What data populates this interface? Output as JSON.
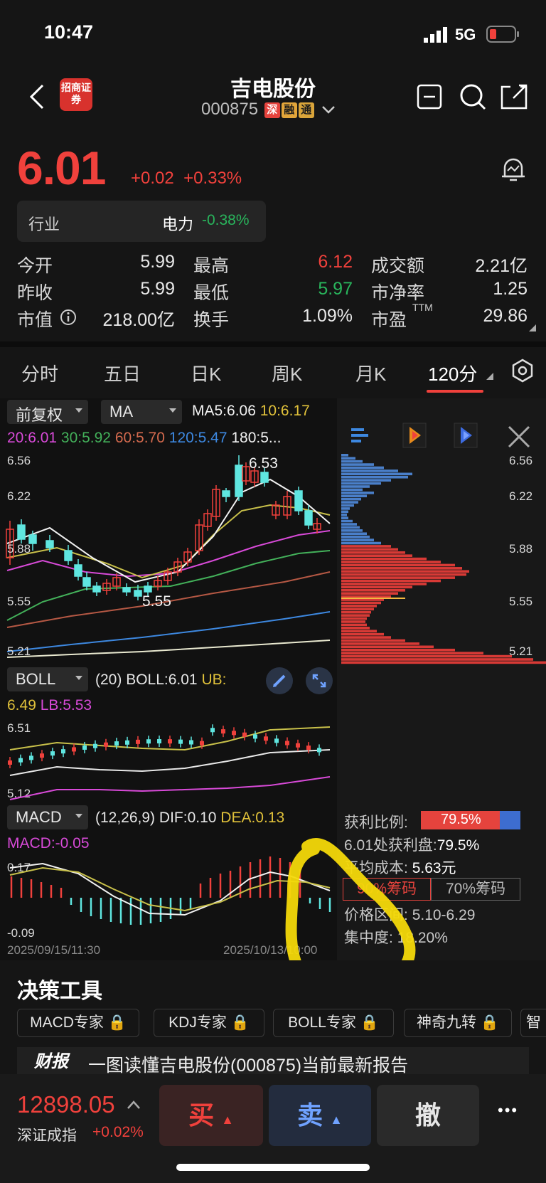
{
  "status": {
    "time": "10:47",
    "network": "5G"
  },
  "header": {
    "broker_logo_text": "招商证券",
    "title": "吉电股份",
    "code": "000875",
    "tags": [
      "深",
      "融",
      "通"
    ]
  },
  "quote": {
    "price": "6.01",
    "change": "+0.02",
    "change_pct": "+0.33%",
    "industry_label": "行业",
    "industry_name": "电力",
    "industry_change": "-0.38%"
  },
  "stats": {
    "open_label": "今开",
    "open": "5.99",
    "high_label": "最高",
    "high": "6.12",
    "turnover_amt_label": "成交额",
    "turnover_amt": "2.21亿",
    "prev_close_label": "昨收",
    "prev_close": "5.99",
    "low_label": "最低",
    "low": "5.97",
    "pb_label": "市净率",
    "pb": "1.25",
    "mcap_label": "市值",
    "mcap": "218.00亿",
    "turnover_label": "换手",
    "turnover": "1.09%",
    "pe_label": "市盈",
    "pe_sup": "TTM",
    "pe": "29.86"
  },
  "tabs": [
    "分时",
    "五日",
    "日K",
    "周K",
    "月K",
    "120分"
  ],
  "kline": {
    "adjust": "前复权",
    "indicator": "MA",
    "ma5": "MA5:6.06",
    "ma10": "10:6.17",
    "ma20": "20:6.01",
    "ma30": "30:5.92",
    "ma60": "60:5.70",
    "ma120": "120:5.47",
    "ma180": "180:5...",
    "y_labels": [
      "6.56",
      "6.22",
      "5.88",
      "5.55",
      "5.21"
    ],
    "high_mark": "6.53",
    "low_mark": "5.55"
  },
  "boll": {
    "name": "BOLL",
    "params": "(20)",
    "value": "BOLL:6.01",
    "ub_label": "UB:",
    "ub": "6.49",
    "lb": "LB:5.53",
    "y_top": "6.51",
    "y_bottom": "5.12"
  },
  "macd": {
    "name": "MACD",
    "params": "(12,26,9)",
    "dif": "DIF:0.10",
    "dea": "DEA:0.13",
    "macd": "MACD:-0.05",
    "y_top": "0.17",
    "y_bottom": "-0.09",
    "x_start": "2025/09/15/11:30",
    "x_end": "2025/10/13/10:00"
  },
  "chips": {
    "y_labels": [
      "6.56",
      "6.22",
      "5.88",
      "5.55",
      "5.21"
    ],
    "profit_ratio_label": "获利比例:",
    "profit_ratio": "79.5%",
    "profit_ratio_value": 0.795,
    "profit_at_label": "6.01处获利盘:",
    "profit_at": "79.5%",
    "avg_cost_label": "平均成本:",
    "avg_cost": "5.63元",
    "btn90": "90%筹码",
    "btn70": "70%筹码",
    "range_label": "价格区间:",
    "range": "5.10-6.29",
    "concentration_label": "集中度:",
    "concentration": "18.20%"
  },
  "decision": {
    "title": "决策工具",
    "tools": [
      "MACD专家",
      "KDJ专家",
      "BOLL专家",
      "神奇九转",
      "智"
    ],
    "report_badge": "财报",
    "report_text": "一图读懂吉电股份(000875)当前最新报告"
  },
  "bottom": {
    "index_value": "12898.05",
    "index_name": "深证成指",
    "index_change": "+0.02%",
    "buy": "买",
    "sell": "卖",
    "cancel": "撤",
    "more": "•••"
  }
}
